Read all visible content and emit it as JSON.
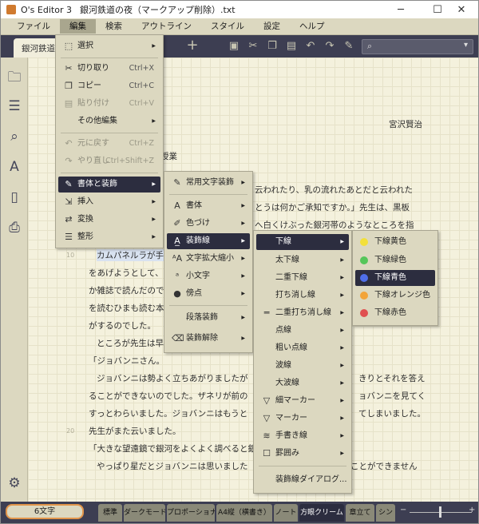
{
  "window": {
    "app": "O's Editor 3",
    "file": "銀河鉄道の夜（マークアップ削除）.txt",
    "minimize": "─",
    "maximize": "☐",
    "close": "✕"
  },
  "menubar": [
    "ファイル",
    "編集",
    "検索",
    "アウトライン",
    "スタイル",
    "設定",
    "ヘルプ"
  ],
  "tab": {
    "label": "銀河鉄道",
    "add": "+"
  },
  "editor": {
    "author": "宮沢賢治",
    "lines": [
      "授業",
      "云われたり、乳の流れたあとだと云われた",
      "とうは何かご承知ですか。」先生は、黒板",
      "へ白くけぶった銀河帯のようなところを指",
      "カムパネルラが手",
      "をあげようとして、",
      "か雑誌で読んだので",
      "を読むひまも読む本",
      "がするのでした。",
      "ところが先生は早",
      "「ジョバンニさん。",
      "ジョバンニは勢よく立ちあがりましたが",
      "きりとそれを答え",
      "ることができないのでした。ザネリが前の",
      "ョバンニを見てく",
      "すっとわらいました。ジョバンニはもうと",
      "てしまいました。",
      "先生がまた云いました。",
      "「大きな望遠鏡で銀河をよくよく調べると銀",
      "やっぱり星だとジョバンニは思いました",
      "ことができません"
    ],
    "line_numbers": [
      "10",
      "20"
    ]
  },
  "edit_menu": {
    "items": [
      {
        "label": "選択",
        "icon": "select-icon",
        "arrow": "▶"
      },
      {
        "label": "切り取り",
        "icon": "scissors-icon",
        "shortcut": "Ctrl+X"
      },
      {
        "label": "コピー",
        "icon": "copy-icon",
        "shortcut": "Ctrl+C"
      },
      {
        "label": "貼り付け",
        "icon": "paste-icon",
        "shortcut": "Ctrl+V"
      },
      {
        "label": "その他編集",
        "arrow": "▶"
      },
      {
        "label": "元に戻す",
        "icon": "undo-icon",
        "shortcut": "Ctrl+Z"
      },
      {
        "label": "やり直し",
        "icon": "redo-icon",
        "shortcut": "Ctrl+Shift+Z"
      },
      {
        "label": "書体と装飾",
        "icon": "style-brush-icon",
        "arrow": "▶"
      },
      {
        "label": "挿入",
        "icon": "insert-icon",
        "arrow": "▶"
      },
      {
        "label": "変換",
        "icon": "convert-icon",
        "arrow": "▶"
      },
      {
        "label": "整形",
        "icon": "format-icon",
        "arrow": "▶"
      }
    ]
  },
  "style_menu": {
    "items": [
      {
        "label": "常用文字装飾",
        "arrow": "▶"
      },
      {
        "label": "書体",
        "arrow": "▶"
      },
      {
        "label": "色づけ",
        "arrow": "▶"
      },
      {
        "label": "装飾線",
        "arrow": "▶"
      },
      {
        "label": "文字拡大縮小",
        "arrow": "▶"
      },
      {
        "label": "小文字",
        "arrow": "▶"
      },
      {
        "label": "傍点",
        "arrow": "▶"
      },
      {
        "label": "段落装飾",
        "arrow": "▶"
      },
      {
        "label": "装飾解除",
        "arrow": "▶"
      }
    ]
  },
  "line_menu": {
    "items": [
      {
        "label": "下線",
        "arrow": "▶"
      },
      {
        "label": "太下線",
        "arrow": "▶"
      },
      {
        "label": "二重下線",
        "arrow": "▶"
      },
      {
        "label": "打ち消し線",
        "arrow": "▶"
      },
      {
        "label": "二重打ち消し線",
        "arrow": "▶"
      },
      {
        "label": "点線",
        "arrow": "▶"
      },
      {
        "label": "粗い点線",
        "arrow": "▶"
      },
      {
        "label": "波線",
        "arrow": "▶"
      },
      {
        "label": "大波線",
        "arrow": "▶"
      },
      {
        "label": "細マーカー",
        "arrow": "▶"
      },
      {
        "label": "マーカー",
        "arrow": "▶"
      },
      {
        "label": "手書き線",
        "arrow": "▶"
      },
      {
        "label": "罫囲み",
        "arrow": "▶"
      },
      {
        "label": "装飾線ダイアログ..."
      }
    ]
  },
  "color_menu": {
    "items": [
      {
        "label": "下線黄色",
        "color": "#f3e03a"
      },
      {
        "label": "下線緑色",
        "color": "#55c65a"
      },
      {
        "label": "下線青色",
        "color": "#4f6ee8"
      },
      {
        "label": "下線オレンジ色",
        "color": "#f2a43a"
      },
      {
        "label": "下線赤色",
        "color": "#e05050"
      }
    ]
  },
  "status": {
    "count": "6文字",
    "tabs": [
      "標準",
      "ダークモード",
      "プロポーショナル",
      "A4縦（横書き）",
      "ノート",
      "方眼クリーム",
      "章立て",
      "シン"
    ],
    "zoom_minus": "−",
    "zoom_plus": "+",
    "zoom_level": 0.47
  }
}
